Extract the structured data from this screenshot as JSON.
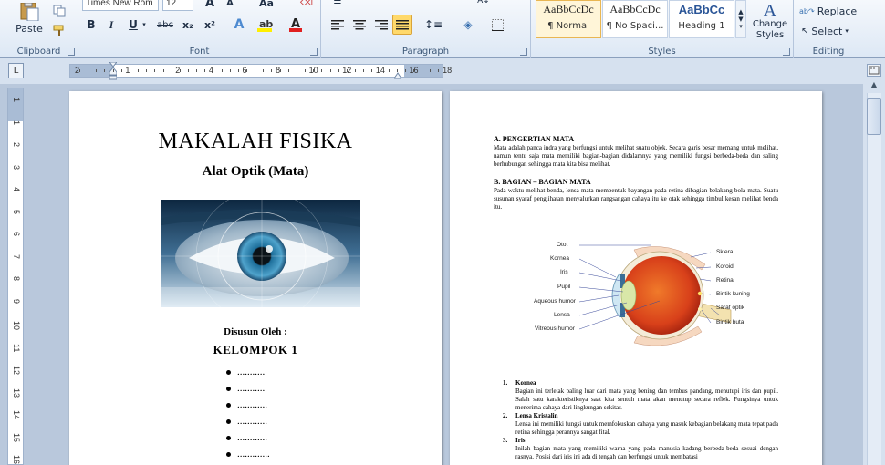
{
  "ribbon": {
    "clipboard": {
      "label": "Clipboard",
      "paste_label": "Paste"
    },
    "font": {
      "label": "Font",
      "font_name": "Times New Rom",
      "font_size": "12",
      "bold": "B",
      "italic": "I",
      "underline": "U",
      "strike": "abc",
      "subscript": "x₂",
      "superscript": "x²"
    },
    "paragraph": {
      "label": "Paragraph"
    },
    "styles": {
      "label": "Styles",
      "tiles": [
        {
          "sample": "AaBbCcDc",
          "name": "¶ Normal"
        },
        {
          "sample": "AaBbCcDc",
          "name": "¶ No Spaci..."
        },
        {
          "sample": "AaBbCc",
          "name": "Heading 1"
        }
      ],
      "change_styles": "Change Styles"
    },
    "editing": {
      "label": "Editing",
      "replace": "Replace",
      "select": "Select"
    }
  },
  "ruler": {
    "numbers": [
      "2",
      "1",
      "2",
      "4",
      "6",
      "8",
      "10",
      "12",
      "14",
      "16",
      "18"
    ],
    "vnumbers": [
      "1",
      "1",
      "2",
      "3",
      "4",
      "5",
      "6",
      "7",
      "8",
      "9",
      "10",
      "11",
      "12",
      "13",
      "14",
      "15",
      "16"
    ]
  },
  "page1": {
    "title": "MAKALAH FISIKA",
    "subtitle": "Alat Optik (Mata)",
    "author_label": "Disusun Oleh :",
    "group": "KELOMPOK 1",
    "members": [
      "...........",
      "...........",
      "............",
      "............",
      "............",
      "............."
    ]
  },
  "page2": {
    "section_a_title": "A. PENGERTIAN MATA",
    "section_a_body": "Mata adalah panca indra yang berfungsi untuk melihat suatu objek. Secara garis besar memang untuk melihat, namun tentu saja mata memiliki bagian-bagian didalamnya yang memiliki fungsi berbeda-beda dan saling berhubungan sehingga mata kita bisa melihat.",
    "section_b_title": "B. BAGIAN – BAGIAN MATA",
    "section_b_body": "Pada waktu melihat benda, lensa mata membentuk bayangan pada retina dibagian belakang bola mata. Suatu susunan syaraf penglihatan menyalurkan rangsangan cahaya itu ke otak sehingga timbul kesan melihat benda itu.",
    "diagram_left": [
      "Otot",
      "Kornea",
      "Iris",
      "Pupil",
      "Aqueous humor",
      "Lensa",
      "Vitreous humor"
    ],
    "diagram_right": [
      "Sklera",
      "Koroid",
      "Retina",
      "Bintik kuning",
      "Saraf optik",
      "Bintik buta"
    ],
    "list": [
      {
        "num": "1.",
        "title": "Kornea",
        "body": "Bagian ini terletak paling luar dari mata yang bening dan tembus pandang, menutupi iris dan pupil. Salah satu karakteristiknya saat kita sentuh mata akan menutup secara reflek. Fungsinya untuk menerima cahaya dari lingkungan sekitar."
      },
      {
        "num": "2.",
        "title": "Lensa Kristalin",
        "body": "Lensa ini memiliki fungsi untuk memfokuskan cahaya yang masuk kebagian belakang mata tepat pada retina sehingga perannya sangat fital."
      },
      {
        "num": "3.",
        "title": "Iris",
        "body": "Inilah bagian mata yang memiliki warna yang pada manusia kadang berbeda-beda sesuai dengan rasnya. Posisi dari iris ini ada di tengah dan berfungsi untuk membatasi"
      }
    ]
  }
}
